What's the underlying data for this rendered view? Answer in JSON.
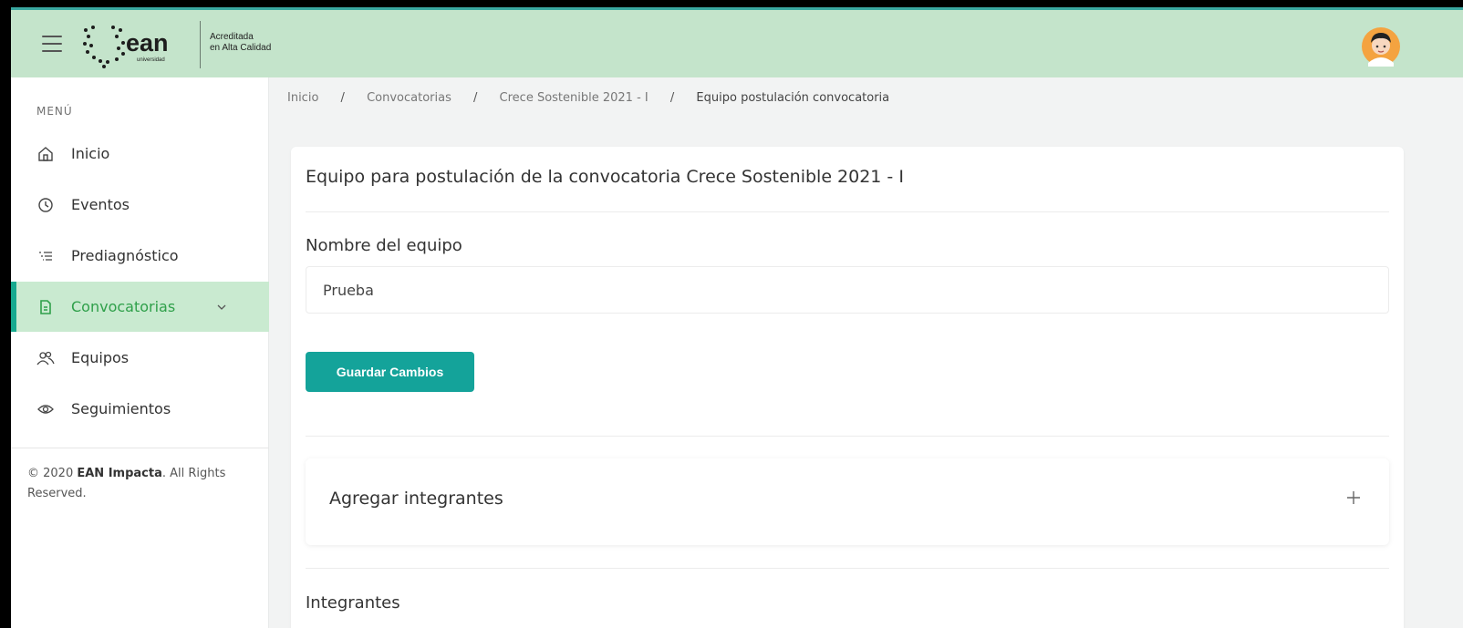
{
  "header": {
    "brand": "ean",
    "brand_sub": "universidad",
    "accreditation_line1": "Acreditada",
    "accreditation_line2": "en Alta Calidad"
  },
  "sidebar": {
    "menu_title": "MENÚ",
    "items": [
      {
        "label": "Inicio",
        "icon": "home-icon"
      },
      {
        "label": "Eventos",
        "icon": "clock-icon"
      },
      {
        "label": "Prediagnóstico",
        "icon": "list-icon"
      },
      {
        "label": "Convocatorias",
        "icon": "document-icon",
        "active": true
      },
      {
        "label": "Equipos",
        "icon": "users-icon"
      },
      {
        "label": "Seguimientos",
        "icon": "eye-icon"
      }
    ],
    "copyright_prefix": "© 2020 ",
    "copyright_brand": "EAN Impacta",
    "copyright_suffix": ". All Rights Reserved."
  },
  "breadcrumb": {
    "items": [
      "Inicio",
      "Convocatorias",
      "Crece Sostenible 2021 - I"
    ],
    "current": "Equipo postulación convocatoria",
    "separator": "/"
  },
  "main": {
    "title": "Equipo para postulación de la convocatoria Crece Sostenible 2021 - I",
    "team_name_label": "Nombre del equipo",
    "team_name_value": "Prueba",
    "save_button": "Guardar Cambios",
    "add_members_label": "Agregar integrantes",
    "members_title": "Integrantes"
  },
  "colors": {
    "topbar": "#c4e4cb",
    "accent": "#14a39a",
    "active_item_bg": "#c9ead0",
    "active_item_text": "#2fa04a"
  }
}
